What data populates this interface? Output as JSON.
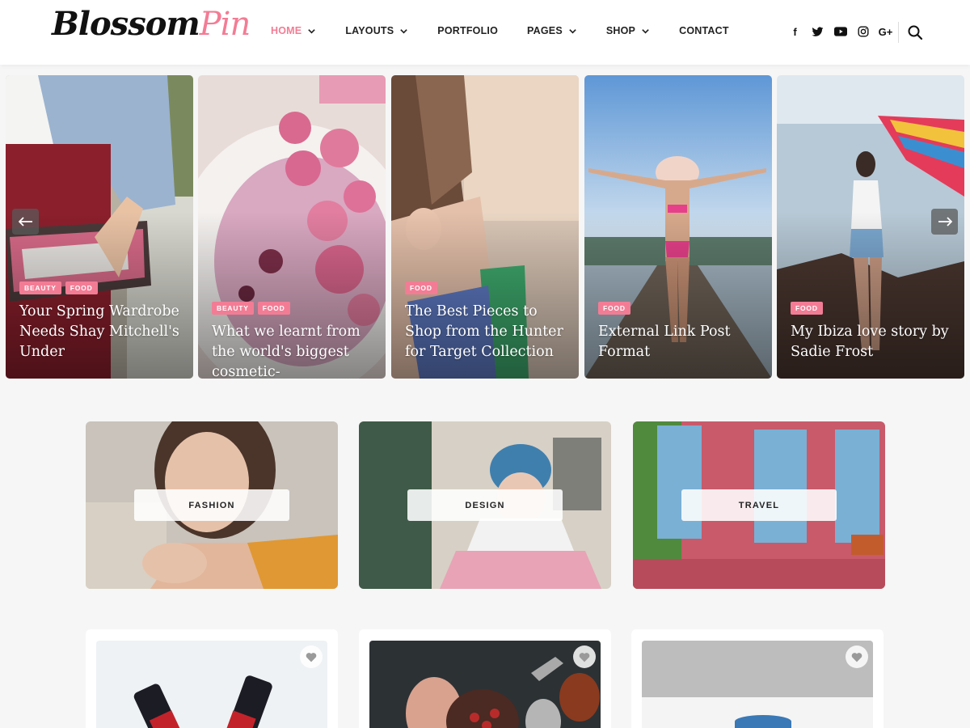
{
  "header": {
    "logo_part1": "Blossom",
    "logo_part2": "Pin",
    "nav": [
      {
        "label": "HOME",
        "has_dropdown": true,
        "active": true
      },
      {
        "label": "LAYOUTS",
        "has_dropdown": true,
        "active": false
      },
      {
        "label": "PORTFOLIO",
        "has_dropdown": false,
        "active": false
      },
      {
        "label": "PAGES",
        "has_dropdown": true,
        "active": false
      },
      {
        "label": "SHOP",
        "has_dropdown": true,
        "active": false
      },
      {
        "label": "CONTACT",
        "has_dropdown": false,
        "active": false
      }
    ],
    "social": [
      {
        "icon": "facebook-icon",
        "glyph": "f"
      },
      {
        "icon": "twitter-icon",
        "glyph": ""
      },
      {
        "icon": "youtube-icon",
        "glyph": ""
      },
      {
        "icon": "instagram-icon",
        "glyph": ""
      },
      {
        "icon": "google-plus-icon",
        "glyph": "G+"
      }
    ],
    "search_icon": "search-icon"
  },
  "slider": {
    "prev_icon": "arrow-left-icon",
    "next_icon": "arrow-right-icon",
    "slides": [
      {
        "tags": [
          "BEAUTY",
          "FOOD"
        ],
        "title": "Your Spring Wardrobe Needs Shay Mitchell's Under"
      },
      {
        "tags": [
          "BEAUTY",
          "FOOD"
        ],
        "title": "What we learnt from the world's biggest cosmetic-"
      },
      {
        "tags": [
          "FOOD"
        ],
        "title": "The Best Pieces to Shop from the Hunter for Target Collection"
      },
      {
        "tags": [
          "FOOD"
        ],
        "title": "External Link Post Format"
      },
      {
        "tags": [
          "FOOD"
        ],
        "title": "My Ibiza love story by Sadie Frost"
      }
    ]
  },
  "categories": [
    {
      "label": "FASHION"
    },
    {
      "label": "DESIGN"
    },
    {
      "label": "TRAVEL"
    }
  ],
  "posts": [
    {
      "favorite_icon": "heart-icon"
    },
    {
      "favorite_icon": "heart-icon"
    },
    {
      "favorite_icon": "heart-icon"
    }
  ],
  "colors": {
    "accent": "#f37c95",
    "background": "#f6f6f6",
    "header_bg": "#ffffff",
    "text": "#222222"
  }
}
